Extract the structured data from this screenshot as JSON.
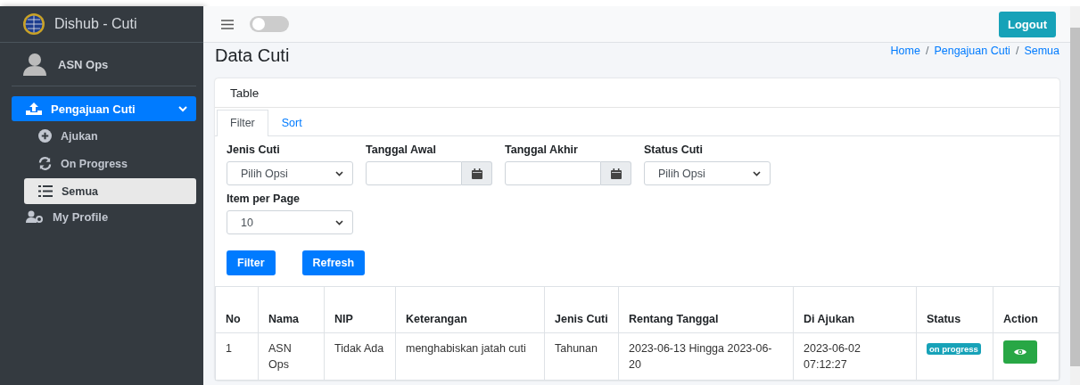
{
  "brand": {
    "title": "Dishub - Cuti"
  },
  "user": {
    "name": "ASN Ops"
  },
  "nav": [
    {
      "label": "Pengajuan Cuti",
      "selected": true,
      "expanded": true,
      "children": [
        {
          "label": "Ajukan",
          "selected": false
        },
        {
          "label": "On Progress",
          "selected": false
        },
        {
          "label": "Semua",
          "selected": true
        }
      ]
    },
    {
      "label": "My Profile",
      "selected": false
    }
  ],
  "topbar": {
    "switch_on": false,
    "logout": "Logout"
  },
  "page": {
    "title": "Data Cuti",
    "breadcrumb": [
      {
        "label": "Home"
      },
      {
        "label": "Pengajuan Cuti"
      },
      {
        "label": "Semua"
      }
    ],
    "separator": "/"
  },
  "card": {
    "title": "Table",
    "tabs": [
      {
        "label": "Filter",
        "selected": true
      },
      {
        "label": "Sort",
        "selected": false
      }
    ],
    "filters": [
      {
        "label": "Jenis Cuti",
        "kind": "select",
        "value": "Pilih Opsi"
      },
      {
        "label": "Tanggal Awal",
        "kind": "date"
      },
      {
        "label": "Tanggal Akhir",
        "kind": "date"
      },
      {
        "label": "Status Cuti",
        "kind": "select",
        "value": "Pilih Opsi"
      },
      {
        "label": "Item per Page",
        "kind": "select",
        "value": "10"
      }
    ],
    "buttons": [
      "Filter",
      "Refresh"
    ]
  },
  "table": {
    "columns": [
      "No",
      "Nama",
      "NIP",
      "Keterangan",
      "Jenis Cuti",
      "Rentang Tanggal",
      "Di Ajukan",
      "Status",
      "Action"
    ],
    "rows": [
      {
        "cells": [
          "1",
          "ASN Ops",
          "Tidak Ada",
          "menghabiskan jatah cuti",
          "Tahunan",
          "2023-06-13 Hingga 2023-06-20",
          "2023-06-02 07:12:27"
        ],
        "status": "on progress"
      }
    ]
  }
}
